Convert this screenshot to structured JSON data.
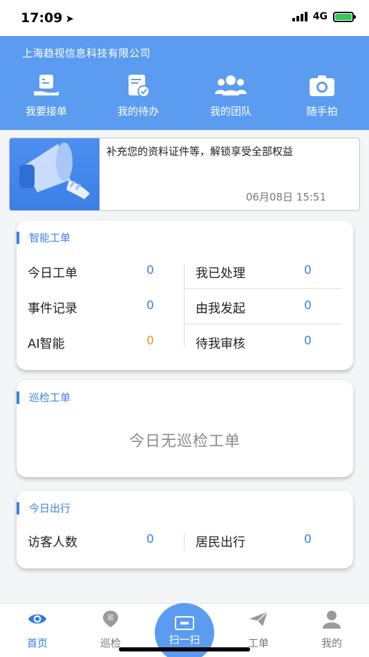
{
  "status": {
    "time": "17:09",
    "network": "4G"
  },
  "header": {
    "company": "上海趋视信息科技有限公司",
    "quick_actions": [
      {
        "label": "我要接单",
        "icon": "hand-document-icon"
      },
      {
        "label": "我的待办",
        "icon": "todo-check-icon"
      },
      {
        "label": "我的团队",
        "icon": "team-icon"
      },
      {
        "label": "随手拍",
        "icon": "camera-icon"
      }
    ]
  },
  "notice": {
    "text": "补充您的资料证件等，解锁享受全部权益",
    "time": "06月08日 15:51",
    "icon": "megaphone-icon"
  },
  "smart_orders": {
    "title": "智能工单",
    "rows": [
      {
        "left_label": "今日工单",
        "left_value": "0",
        "right_label": "我已处理",
        "right_value": "0"
      },
      {
        "left_label": "事件记录",
        "left_value": "0",
        "right_label": "由我发起",
        "right_value": "0"
      },
      {
        "left_label": "AI智能",
        "left_value": "0",
        "right_label": "待我审核",
        "right_value": "0"
      }
    ]
  },
  "patrol": {
    "title": "巡检工单",
    "empty_text": "今日无巡检工单"
  },
  "travel": {
    "title": "今日出行",
    "left_label": "访客人数",
    "left_value": "0",
    "right_label": "居民出行",
    "right_value": "0"
  },
  "tabbar": {
    "tabs": [
      {
        "label": "首页",
        "icon": "eye-icon",
        "active": true
      },
      {
        "label": "巡检",
        "icon": "patrol-pin-icon"
      },
      {
        "label": "扫一扫",
        "icon": "scan-icon"
      },
      {
        "label": "工单",
        "icon": "paper-plane-icon"
      },
      {
        "label": "我的",
        "icon": "user-icon"
      }
    ]
  },
  "colors": {
    "primary": "#5b9cf1",
    "accent": "#3b82e6",
    "orange": "#e9942b"
  }
}
